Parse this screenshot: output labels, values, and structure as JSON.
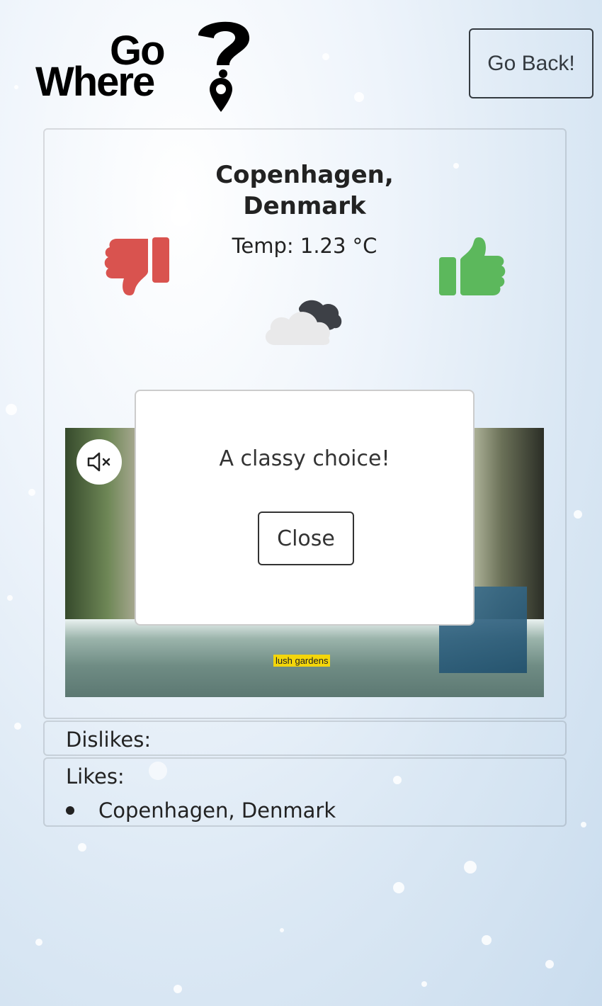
{
  "header": {
    "logo_line1": "Go",
    "logo_line2": "Where",
    "back_label": "Go Back!"
  },
  "destination": {
    "city": "Copenhagen,",
    "country": "Denmark",
    "temp": "Temp: 1.23 °C",
    "weather_icon": "cloud-night-icon"
  },
  "video": {
    "caption": "lush gardens",
    "mute_icon": "mute-icon"
  },
  "modal": {
    "message": "A classy choice!",
    "close_label": "Close"
  },
  "dislikes": {
    "title": "Dislikes:",
    "items": []
  },
  "likes": {
    "title": "Likes:",
    "items": [
      "Copenhagen, Denmark"
    ]
  },
  "colors": {
    "dislike": "#d9534f",
    "like": "#5cb85c"
  }
}
